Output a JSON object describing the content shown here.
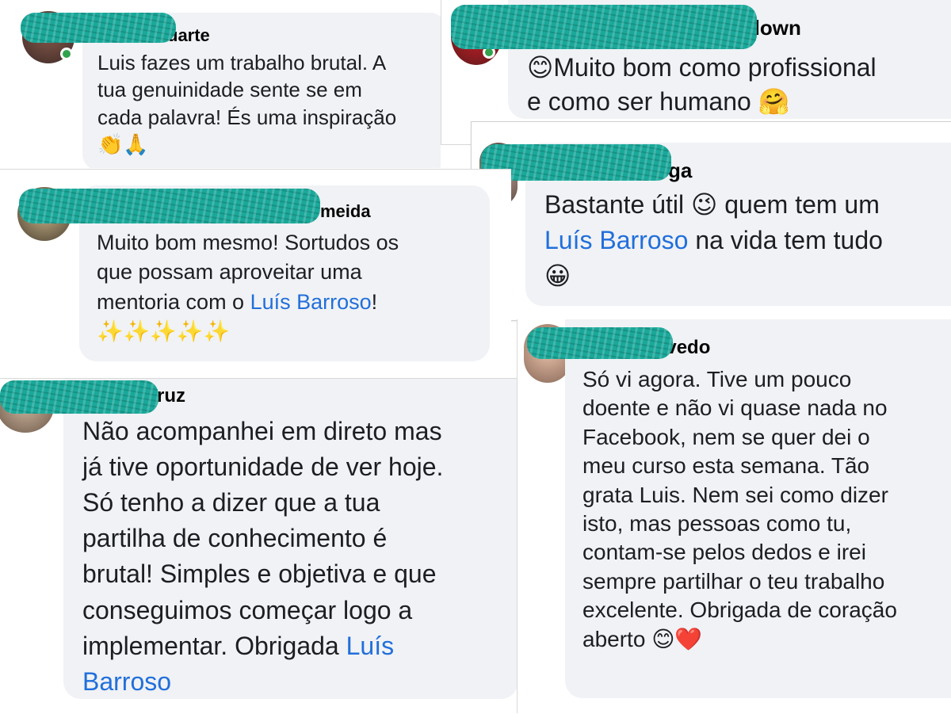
{
  "comments": [
    {
      "name": "uarte",
      "lines": [
        "Luis fazes um trabalho brutal. A",
        "tua genuinidade sente se em",
        "cada palavra! És uma inspiração"
      ],
      "emoji": "👏🙏"
    },
    {
      "name": "down",
      "line1": "Muito bom como profissional",
      "line2": "e como ser humano",
      "emoji_start": "😊",
      "emoji_end": "🤗"
    },
    {
      "name": "ga",
      "line1_a": "Bastante útil",
      "line1_emoji": "😉",
      "line1_b": "quem tem um",
      "mention": "Luís Barroso",
      "line2_rest": "na vida tem tudo",
      "emoji_end": "😀"
    },
    {
      "name": "meida",
      "lines": [
        "Muito bom mesmo! Sortudos os",
        "que possam aproveitar uma"
      ],
      "line3_a": "mentoria com o",
      "mention": "Luís Barroso",
      "line3_b": "!",
      "emoji": "✨✨✨✨✨"
    },
    {
      "name": "evedo",
      "lines": [
        "Só vi agora. Tive um pouco",
        "doente e não vi quase nada no",
        "Facebook, nem se quer dei o",
        "meu curso esta semana. Tão",
        "grata Luis. Nem sei como dizer",
        "isto, mas pessoas como tu,",
        "contam-se pelos dedos e irei",
        "sempre partilhar o teu trabalho",
        "excelente. Obrigada de coração"
      ],
      "last_line": "aberto",
      "emoji": "😊❤️"
    },
    {
      "name": "ruz",
      "lines": [
        "Não acompanhei em direto mas",
        "já tive oportunidade de ver hoje.",
        "Só tenho a dizer que a tua",
        "partilha de conhecimento é",
        "brutal! Simples e objetiva e que",
        "conseguimos começar logo a"
      ],
      "line7_a": "implementar. Obrigada",
      "mention_a": "Luís",
      "mention_b": "Barroso"
    }
  ],
  "colors": {
    "bubble": "#f0f2f5",
    "mention": "#216fdb",
    "online": "#31a24c",
    "redaction": "#1aa89a"
  }
}
